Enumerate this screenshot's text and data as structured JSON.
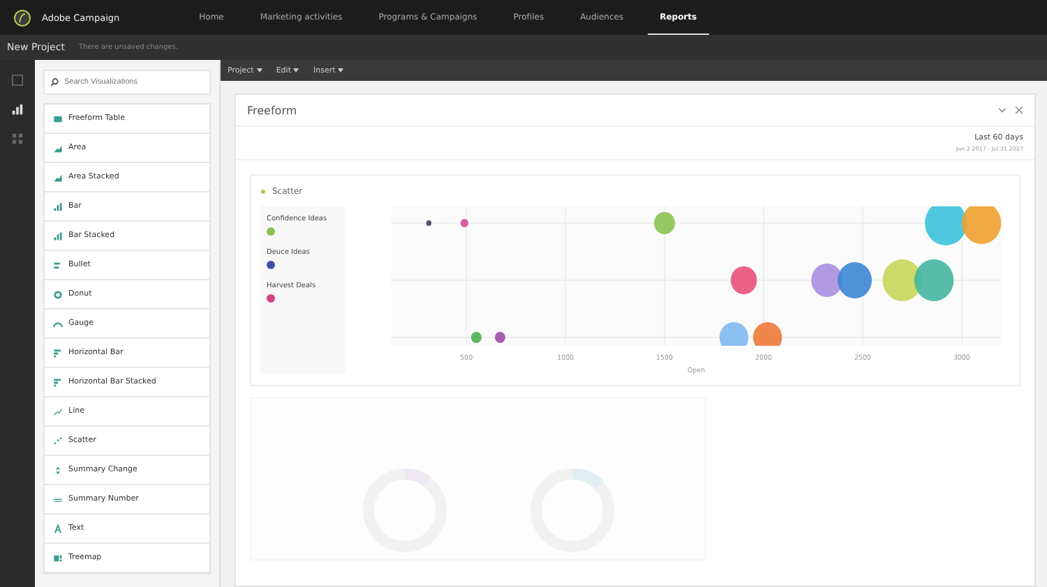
{
  "app": {
    "name": "Adobe Campaign"
  },
  "nav": [
    {
      "label": "Home",
      "selected": false
    },
    {
      "label": "Marketing activities",
      "selected": false
    },
    {
      "label": "Programs & Campaigns",
      "selected": false
    },
    {
      "label": "Profiles",
      "selected": false
    },
    {
      "label": "Audiences",
      "selected": false
    },
    {
      "label": "Reports",
      "selected": true
    }
  ],
  "project": {
    "title": "New Project",
    "notice": "There are unsaved changes."
  },
  "rail": [
    {
      "kind": "panel",
      "selected": false
    },
    {
      "kind": "chart",
      "selected": true
    },
    {
      "kind": "grid",
      "selected": false
    }
  ],
  "menus": [
    "Project",
    "Edit",
    "Insert"
  ],
  "search": {
    "placeholder": "Search Visualizations"
  },
  "visualizations": [
    {
      "label": "Freeform Table",
      "kind": "table"
    },
    {
      "label": "Area",
      "kind": "area"
    },
    {
      "label": "Area Stacked",
      "kind": "area"
    },
    {
      "label": "Bar",
      "kind": "bar"
    },
    {
      "label": "Bar Stacked",
      "kind": "bar"
    },
    {
      "label": "Bullet",
      "kind": "bullet"
    },
    {
      "label": "Donut",
      "kind": "donut"
    },
    {
      "label": "Gauge",
      "kind": "gauge"
    },
    {
      "label": "Horizontal Bar",
      "kind": "hbar"
    },
    {
      "label": "Horizontal Bar Stacked",
      "kind": "hbar"
    },
    {
      "label": "Line",
      "kind": "line"
    },
    {
      "label": "Scatter",
      "kind": "scatter"
    },
    {
      "label": "Summary Change",
      "kind": "change"
    },
    {
      "label": "Summary Number",
      "kind": "number"
    },
    {
      "label": "Text",
      "kind": "text"
    },
    {
      "label": "Treemap",
      "kind": "treemap"
    }
  ],
  "panel": {
    "title": "Freeform",
    "range": "Last 60 days",
    "dates": "Jun 2 2017 - Jul 31 2017"
  },
  "scatter": {
    "title": "Scatter",
    "legend": [
      {
        "label": "Confidence Ideas",
        "color": "#8cc152"
      },
      {
        "label": "Deuce Ideas",
        "color": "#3f51a5"
      },
      {
        "label": "Harvest Deals",
        "color": "#d63f85"
      }
    ],
    "x_ticks": [
      "500",
      "1000",
      "1500",
      "2000",
      "2500",
      "3000"
    ],
    "x_title": "Open"
  }
}
